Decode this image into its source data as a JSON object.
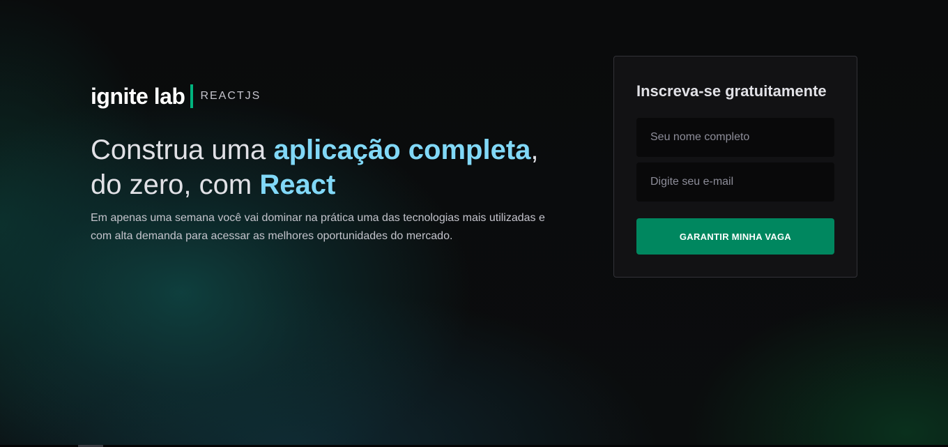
{
  "brand": {
    "name": "ignite lab",
    "track": "REACTJS",
    "accent_color": "#00b37e"
  },
  "hero": {
    "headline_part1": "Construa uma ",
    "headline_highlight1": "aplicação completa",
    "headline_part2": ",",
    "headline_part3": "do zero, com ",
    "headline_highlight2": "React",
    "description": "Em apenas uma semana você vai dominar na prática uma das tecnologias mais utilizadas e com alta demanda para acessar as melhores oportunidades do mercado.",
    "highlight_color": "#81d8f7"
  },
  "signup": {
    "title": "Inscreva-se gratuitamente",
    "name_placeholder": "Seu nome completo",
    "name_value": "",
    "email_placeholder": "Digite seu e-mail",
    "email_value": "",
    "submit_label": "GARANTIR MINHA VAGA",
    "button_color": "#00875f"
  }
}
